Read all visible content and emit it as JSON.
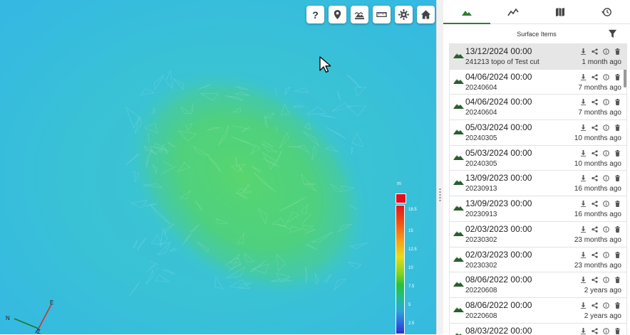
{
  "toolbar": {
    "buttons": [
      {
        "name": "help-icon",
        "label": "?"
      },
      {
        "name": "location-pin-icon",
        "label": ""
      },
      {
        "name": "layers-icon",
        "label": ""
      },
      {
        "name": "ruler-icon",
        "label": ""
      },
      {
        "name": "gear-icon",
        "label": ""
      },
      {
        "name": "home-icon",
        "label": ""
      }
    ]
  },
  "legend": {
    "unit": "m",
    "ticks": [
      "18.5",
      "15",
      "12.5",
      "10",
      "7.5",
      "5",
      "2.5"
    ],
    "top_color": "#e1101c"
  },
  "axes": {
    "n_label": "N",
    "e_label": "E",
    "z_label": "Z"
  },
  "panel": {
    "tabs": [
      {
        "name": "tab-surfaces",
        "icon": "mountain-icon",
        "active": true
      },
      {
        "name": "tab-profile",
        "icon": "line-chart-icon",
        "active": false
      },
      {
        "name": "tab-map",
        "icon": "map-icon",
        "active": false
      },
      {
        "name": "tab-history",
        "icon": "history-icon",
        "active": false
      }
    ],
    "section_title": "Surface Items",
    "accent_color": "#2e7d32",
    "items": [
      {
        "date": "13/12/2024 00:00",
        "name": "241213 topo of Test cut",
        "ago": "1 month ago",
        "selected": true
      },
      {
        "date": "04/06/2024 00:00",
        "name": "20240604",
        "ago": "7 months ago",
        "current": true
      },
      {
        "date": "04/06/2024 00:00",
        "name": "20240604",
        "ago": "7 months ago"
      },
      {
        "date": "05/03/2024 00:00",
        "name": "20240305",
        "ago": "10 months ago"
      },
      {
        "date": "05/03/2024 00:00",
        "name": "20240305",
        "ago": "10 months ago"
      },
      {
        "date": "13/09/2023 00:00",
        "name": "20230913",
        "ago": "16 months ago"
      },
      {
        "date": "13/09/2023 00:00",
        "name": "20230913",
        "ago": "16 months ago"
      },
      {
        "date": "02/03/2023 00:00",
        "name": "20230302",
        "ago": "23 months ago"
      },
      {
        "date": "02/03/2023 00:00",
        "name": "20230302",
        "ago": "23 months ago"
      },
      {
        "date": "08/06/2022 00:00",
        "name": "20220608",
        "ago": "2 years ago"
      },
      {
        "date": "08/06/2022 00:00",
        "name": "20220608",
        "ago": "2 years ago"
      },
      {
        "date": "08/03/2022 00:00",
        "name": "",
        "ago": ""
      }
    ],
    "item_actions": [
      "download-icon",
      "share-icon",
      "info-icon",
      "delete-icon"
    ]
  }
}
